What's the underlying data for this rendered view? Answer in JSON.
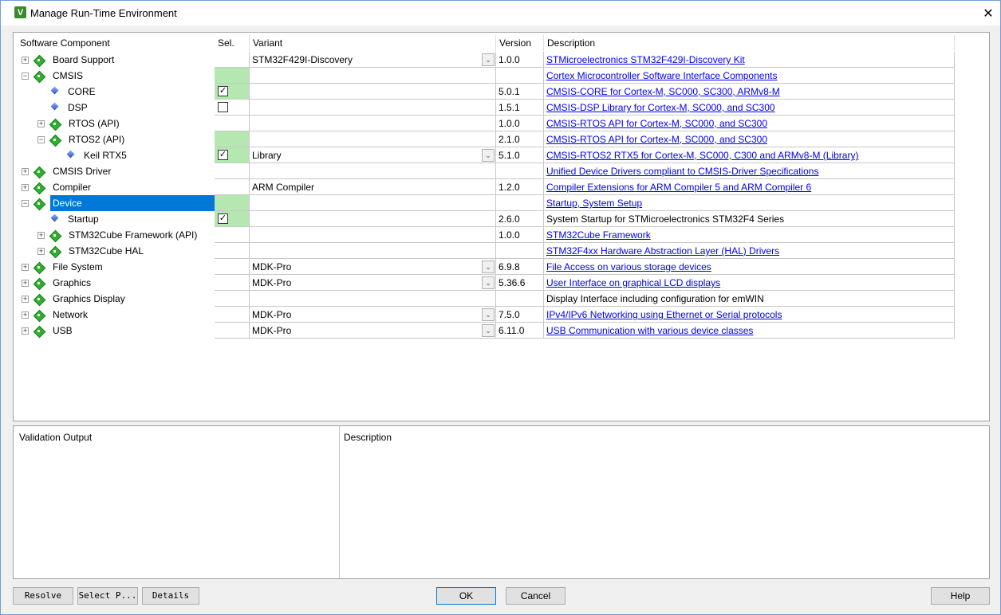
{
  "window": {
    "title": "Manage Run-Time Environment",
    "icon": "V"
  },
  "columns": {
    "component": "Software Component",
    "sel": "Sel.",
    "variant": "Variant",
    "version": "Version",
    "description": "Description"
  },
  "rows": [
    {
      "name": "Board Support",
      "level": 0,
      "expander": "+",
      "icon": "diamond-icon",
      "sel": "",
      "sel_green": false,
      "variant": "STM32F429I-Discovery",
      "dropdown": true,
      "version": "1.0.0",
      "desc": "STMicroelectronics STM32F429I-Discovery Kit",
      "link": true
    },
    {
      "name": "CMSIS",
      "level": 0,
      "expander": "-",
      "icon": "diamond-icon",
      "sel": "",
      "sel_green": true,
      "variant": "",
      "dropdown": false,
      "version": "",
      "desc": "Cortex Microcontroller Software Interface Components",
      "link": true
    },
    {
      "name": "CORE",
      "level": 1,
      "expander": "",
      "icon": "gem-icon",
      "sel": "checked",
      "sel_green": true,
      "variant": "",
      "dropdown": false,
      "version": "5.0.1",
      "desc": "CMSIS-CORE for Cortex-M, SC000, SC300, ARMv8-M",
      "link": true
    },
    {
      "name": "DSP",
      "level": 1,
      "expander": "",
      "icon": "gem-icon",
      "sel": "unchecked",
      "sel_green": false,
      "variant": "",
      "dropdown": false,
      "version": "1.5.1",
      "desc": "CMSIS-DSP Library for Cortex-M, SC000, and SC300",
      "link": true
    },
    {
      "name": "RTOS (API)",
      "level": 1,
      "expander": "+",
      "icon": "diamond-icon",
      "sel": "",
      "sel_green": false,
      "variant": "",
      "dropdown": false,
      "version": "1.0.0",
      "desc": "CMSIS-RTOS API for Cortex-M, SC000, and SC300",
      "link": true
    },
    {
      "name": "RTOS2 (API)",
      "level": 1,
      "expander": "-",
      "icon": "diamond-icon",
      "sel": "",
      "sel_green": true,
      "variant": "",
      "dropdown": false,
      "version": "2.1.0",
      "desc": "CMSIS-RTOS API for Cortex-M, SC000, and SC300",
      "link": true
    },
    {
      "name": "Keil RTX5",
      "level": 2,
      "expander": "",
      "icon": "gem-icon",
      "sel": "checked",
      "sel_green": true,
      "variant": "Library",
      "dropdown": true,
      "version": "5.1.0",
      "desc": "CMSIS-RTOS2 RTX5 for Cortex-M, SC000, C300 and ARMv8-M (Library)",
      "link": true
    },
    {
      "name": "CMSIS Driver",
      "level": 0,
      "expander": "+",
      "icon": "diamond-icon",
      "sel": "",
      "sel_green": false,
      "variant": "",
      "dropdown": false,
      "version": "",
      "desc": "Unified Device Drivers compliant to CMSIS-Driver Specifications",
      "link": true
    },
    {
      "name": "Compiler",
      "level": 0,
      "expander": "+",
      "icon": "diamond-icon",
      "sel": "",
      "sel_green": false,
      "variant": "ARM Compiler",
      "dropdown": false,
      "version": "1.2.0",
      "desc": "Compiler Extensions for ARM Compiler 5 and ARM Compiler 6",
      "link": true
    },
    {
      "name": "Device",
      "level": 0,
      "expander": "-",
      "icon": "diamond-icon",
      "sel": "",
      "sel_green": true,
      "variant": "",
      "dropdown": false,
      "version": "",
      "desc": "Startup, System Setup",
      "link": true,
      "selected": true
    },
    {
      "name": "Startup",
      "level": 1,
      "expander": "",
      "icon": "gem-icon",
      "sel": "checked",
      "sel_green": true,
      "variant": "",
      "dropdown": false,
      "version": "2.6.0",
      "desc": "System Startup for STMicroelectronics STM32F4 Series",
      "link": false
    },
    {
      "name": "STM32Cube Framework (API)",
      "level": 1,
      "expander": "+",
      "icon": "diamond-icon",
      "sel": "",
      "sel_green": false,
      "variant": "",
      "dropdown": false,
      "version": "1.0.0",
      "desc": "STM32Cube Framework",
      "link": true
    },
    {
      "name": "STM32Cube HAL",
      "level": 1,
      "expander": "+",
      "icon": "diamond-icon",
      "sel": "",
      "sel_green": false,
      "variant": "",
      "dropdown": false,
      "version": "",
      "desc": "STM32F4xx Hardware Abstraction Layer (HAL) Drivers",
      "link": true
    },
    {
      "name": "File System",
      "level": 0,
      "expander": "+",
      "icon": "diamond-icon",
      "sel": "",
      "sel_green": false,
      "variant": "MDK-Pro",
      "dropdown": true,
      "version": "6.9.8",
      "desc": "File Access on various storage devices",
      "link": true
    },
    {
      "name": "Graphics",
      "level": 0,
      "expander": "+",
      "icon": "diamond-icon",
      "sel": "",
      "sel_green": false,
      "variant": "MDK-Pro",
      "dropdown": true,
      "version": "5.36.6",
      "desc": "User Interface on graphical LCD displays",
      "link": true
    },
    {
      "name": "Graphics Display",
      "level": 0,
      "expander": "+",
      "icon": "diamond-icon",
      "sel": "",
      "sel_green": false,
      "variant": "",
      "dropdown": false,
      "version": "",
      "desc": "Display Interface including configuration for emWIN",
      "link": false
    },
    {
      "name": "Network",
      "level": 0,
      "expander": "+",
      "icon": "diamond-icon",
      "sel": "",
      "sel_green": false,
      "variant": "MDK-Pro",
      "dropdown": true,
      "version": "7.5.0",
      "desc": "IPv4/IPv6 Networking using Ethernet or Serial protocols",
      "link": true
    },
    {
      "name": "USB",
      "level": 0,
      "expander": "+",
      "icon": "diamond-icon",
      "sel": "",
      "sel_green": false,
      "variant": "MDK-Pro",
      "dropdown": true,
      "version": "6.11.0",
      "desc": "USB Communication with various device classes",
      "link": true
    }
  ],
  "bottom": {
    "validation_output": "Validation Output",
    "description": "Description"
  },
  "buttons": {
    "resolve": "Resolve",
    "select": "Select P...",
    "details": "Details",
    "ok": "OK",
    "cancel": "Cancel",
    "help": "Help"
  },
  "colors": {
    "selection": "#0078d7",
    "sel_green": "#b4e8b0",
    "link": "#0000ee"
  }
}
